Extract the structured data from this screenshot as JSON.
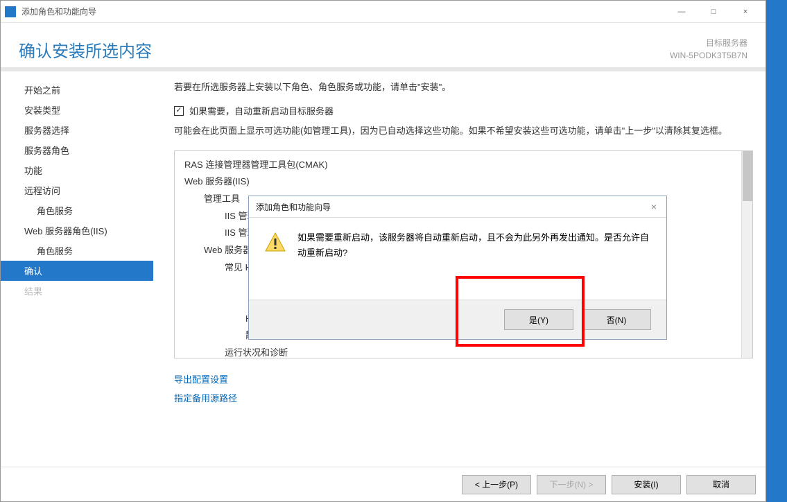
{
  "window": {
    "title": "添加角色和功能向导",
    "close": "×",
    "minimize": "—",
    "maximize": "□"
  },
  "header": {
    "title": "确认安装所选内容",
    "dest_label": "目标服务器",
    "dest_server": "WIN-5PODK3T5B7N"
  },
  "sidebar": {
    "items": [
      {
        "label": "开始之前"
      },
      {
        "label": "安装类型"
      },
      {
        "label": "服务器选择"
      },
      {
        "label": "服务器角色"
      },
      {
        "label": "功能"
      },
      {
        "label": "远程访问"
      },
      {
        "label": "角色服务",
        "sub": true
      },
      {
        "label": "Web 服务器角色(IIS)"
      },
      {
        "label": "角色服务",
        "sub": true
      },
      {
        "label": "确认",
        "selected": true
      },
      {
        "label": "结果",
        "dim": true
      }
    ]
  },
  "content": {
    "prompt": "若要在所选服务器上安装以下角色、角色服务或功能，请单击\"安装\"。",
    "checkbox_label": "如果需要，自动重新启动目标服务器",
    "optional_note": "可能会在此页面上显示可选功能(如管理工具)，因为已自动选择这些功能。如果不希望安装这些可选功能，请单击\"上一步\"以清除其复选框。",
    "roles": [
      {
        "label": "RAS 连接管理器管理工具包(CMAK)",
        "cls": "lvl1"
      },
      {
        "label": "Web 服务器(IIS)",
        "cls": "lvl1"
      },
      {
        "label": "管理工具",
        "cls": "lvl2"
      },
      {
        "label": "IIS 管理控制台",
        "cls": "lvl3"
      },
      {
        "label": "IIS 管理脚本和工具",
        "cls": "lvl3"
      },
      {
        "label": "Web 服务器",
        "cls": "lvl2"
      },
      {
        "label": "常见 HTTP 功能",
        "cls": "lvl3"
      },
      {
        "label": "",
        "cls": "lvl4"
      },
      {
        "label": "",
        "cls": "lvl4"
      },
      {
        "label": "HTTP 错误",
        "cls": "lvl4"
      },
      {
        "label": "静态内容",
        "cls": "lvl4"
      },
      {
        "label": "运行状况和诊断",
        "cls": "lvl3"
      }
    ],
    "links": {
      "export": "导出配置设置",
      "alt_source": "指定备用源路径"
    }
  },
  "footer": {
    "prev": "< 上一步(P)",
    "next": "下一步(N) >",
    "install": "安装(I)",
    "cancel": "取消"
  },
  "modal": {
    "title": "添加角色和功能向导",
    "message": "如果需要重新启动，该服务器将自动重新启动，且不会为此另外再发出通知。是否允许自动重新启动?",
    "yes": "是(Y)",
    "no": "否(N)"
  }
}
